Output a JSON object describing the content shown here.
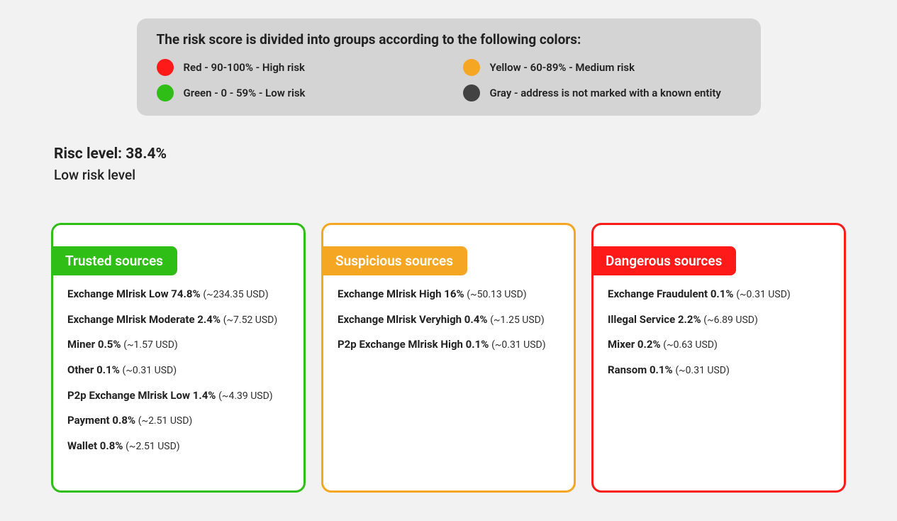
{
  "legend": {
    "title": "The risk score is divided into groups according to the following colors:",
    "items": [
      {
        "color": "#ff1a1a",
        "text": "Red - 90-100% - High risk"
      },
      {
        "color": "#f5a623",
        "text": "Yellow - 60-89% - Medium risk"
      },
      {
        "color": "#2fbe15",
        "text": "Green - 0 - 59% - Low risk"
      },
      {
        "color": "#424242",
        "text": "Gray - address is not marked with a known entity"
      }
    ]
  },
  "risk": {
    "level_line": "Risc level: 38.4%",
    "label_line": "Low risk level"
  },
  "cards": [
    {
      "title": "Trusted sources",
      "color": "#2fbe15",
      "items": [
        {
          "main": "Exchange Mlrisk Low 74.8%",
          "usd": "(~234.35 USD)"
        },
        {
          "main": "Exchange Mlrisk Moderate 2.4%",
          "usd": "(~7.52 USD)"
        },
        {
          "main": "Miner 0.5%",
          "usd": "(~1.57 USD)"
        },
        {
          "main": "Other 0.1%",
          "usd": "(~0.31 USD)"
        },
        {
          "main": "P2p Exchange Mlrisk Low 1.4%",
          "usd": "(~4.39 USD)"
        },
        {
          "main": "Payment 0.8%",
          "usd": "(~2.51 USD)"
        },
        {
          "main": "Wallet 0.8%",
          "usd": "(~2.51 USD)"
        }
      ]
    },
    {
      "title": "Suspicious sources",
      "color": "#f5a623",
      "items": [
        {
          "main": "Exchange Mlrisk High 16%",
          "usd": "(~50.13 USD)"
        },
        {
          "main": "Exchange Mlrisk Veryhigh 0.4%",
          "usd": "(~1.25 USD)"
        },
        {
          "main": "P2p Exchange Mlrisk High 0.1%",
          "usd": "(~0.31 USD)"
        }
      ]
    },
    {
      "title": "Dangerous sources",
      "color": "#ff1a1a",
      "items": [
        {
          "main": "Exchange Fraudulent 0.1%",
          "usd": "(~0.31 USD)"
        },
        {
          "main": "Illegal Service 2.2%",
          "usd": "(~6.89 USD)"
        },
        {
          "main": "Mixer 0.2%",
          "usd": "(~0.63 USD)"
        },
        {
          "main": "Ransom 0.1%",
          "usd": "(~0.31 USD)"
        }
      ]
    }
  ]
}
